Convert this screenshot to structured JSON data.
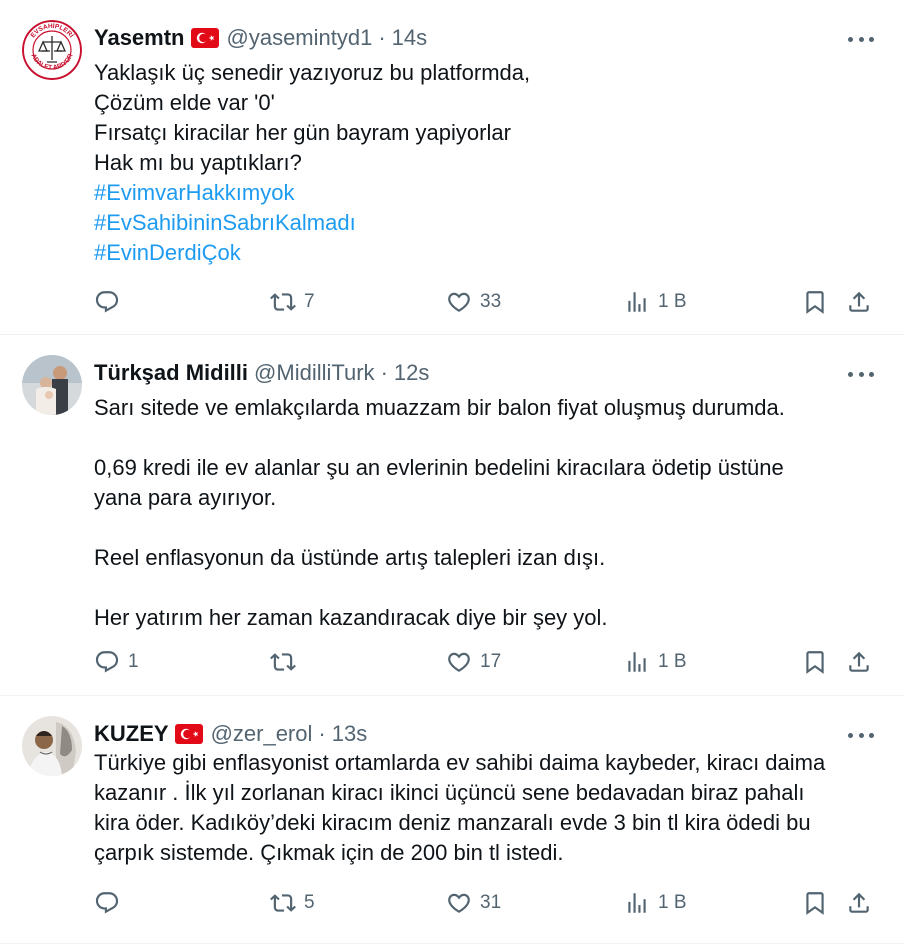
{
  "tweets": [
    {
      "name": "Yasemtn",
      "flag": true,
      "handle": "@yasemintyd1",
      "separator": "·",
      "time": "14s",
      "lines": [
        "Yaklaşık üç senedir yazıyoruz bu platformda,",
        "Çözüm elde  var '0'",
        "Fırsatçı kiracilar her gün bayram yapiyorlar",
        "Hak mı bu yaptıkları?"
      ],
      "hashtags": [
        "#EvimvarHakkımyok",
        "#EvSahibininSabrıKalmadı",
        "#EvinDerdiÇok"
      ],
      "avatar_text": [
        "EVSAHİPLERİ",
        "ADALET ARIYOR"
      ],
      "replies": "",
      "reposts": "7",
      "likes": "33",
      "views": "1 B"
    },
    {
      "name": "Türkşad Midilli",
      "flag": false,
      "handle": "@MidilliTurk",
      "separator": "·",
      "time": "12s",
      "lines": [
        "Sarı sitede ve emlakçılarda muazzam bir balon fiyat oluşmuş durumda.",
        "",
        "0,69 kredi ile ev alanlar şu an evlerinin bedelini kiracılara ödetip üstüne",
        "yana para ayırıyor.",
        "",
        "Reel enflasyonun da üstünde artış talepleri izan dışı.",
        "",
        "Her yatırım her zaman kazandıracak diye bir şey yol."
      ],
      "replies": "1",
      "reposts": "",
      "likes": "17",
      "views": "1 B"
    },
    {
      "name": "KUZEY",
      "flag": true,
      "handle": "@zer_erol",
      "separator": "·",
      "time": "13s",
      "lines": [
        "Türkiye gibi enflasyonist ortamlarda ev sahibi daima kaybeder, kiracı daima",
        "kazanır . İlk yıl zorlanan kiracı ikinci üçüncü sene bedavadan biraz pahalı",
        "kira öder.  Kadıköy’deki kiracım deniz manzaralı evde 3 bin tl kira ödedi bu",
        "çarpık sistemde. Çıkmak için de 200 bin tl istedi."
      ],
      "replies": "",
      "reposts": "5",
      "likes": "31",
      "views": "1 B"
    }
  ],
  "colors": {
    "text": "#0f1419",
    "secondary": "#536471",
    "hashtag": "#1d9bf0",
    "divider": "#eff3f4",
    "flag_red": "#e30a17"
  },
  "icons": [
    "reply-icon",
    "repost-icon",
    "like-icon",
    "views-icon",
    "bookmark-icon",
    "share-icon",
    "more-icon",
    "turkish-flag-icon"
  ]
}
